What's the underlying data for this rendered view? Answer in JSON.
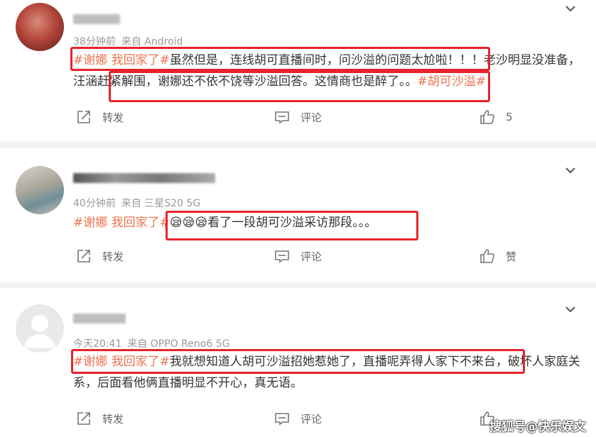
{
  "comments": [
    {
      "meta_time": "38分钟前",
      "meta_source": "来自 Android",
      "text_parts": [
        {
          "t": "#谢娜 我回家了#",
          "tag": true
        },
        {
          "t": "虽然但是，连线胡可直播间时，问沙溢的问题太尬啦！！！老沙明显没准备，汪涵赶紧解围，谢娜还不依不饶等沙溢回答。这情商也是醉了。。",
          "tag": false
        },
        {
          "t": "#胡可沙溢#",
          "tag": true
        }
      ],
      "repost_label": "转发",
      "comment_label": "评论",
      "like_label": "5"
    },
    {
      "meta_time": "40分钟前",
      "meta_source": "来自 三星S20 5G",
      "text_parts": [
        {
          "t": "#谢娜 我回家了#",
          "tag": true
        },
        {
          "t": "😪😪😪看了一段胡可沙溢采访那段。。。",
          "tag": false
        }
      ],
      "repost_label": "转发",
      "comment_label": "评论",
      "like_label": "赞"
    },
    {
      "meta_time": "今天20:41",
      "meta_source": "来自 OPPO Reno6 5G",
      "text_parts": [
        {
          "t": "#谢娜 我回家了#",
          "tag": true
        },
        {
          "t": "我就想知道人胡可沙溢招她惹她了，直播呢弄得人家下不来台，破坏人家庭关系，后面看他俩直播明显不开心，真无语。",
          "tag": false
        }
      ],
      "repost_label": "转发",
      "comment_label": "评论",
      "like_label": ""
    }
  ],
  "watermark": "搜狐号@快乐娱文",
  "colors": {
    "tag": "#eb7350",
    "highlight_box": "#e8232b",
    "separator": "#f2f2f2"
  }
}
